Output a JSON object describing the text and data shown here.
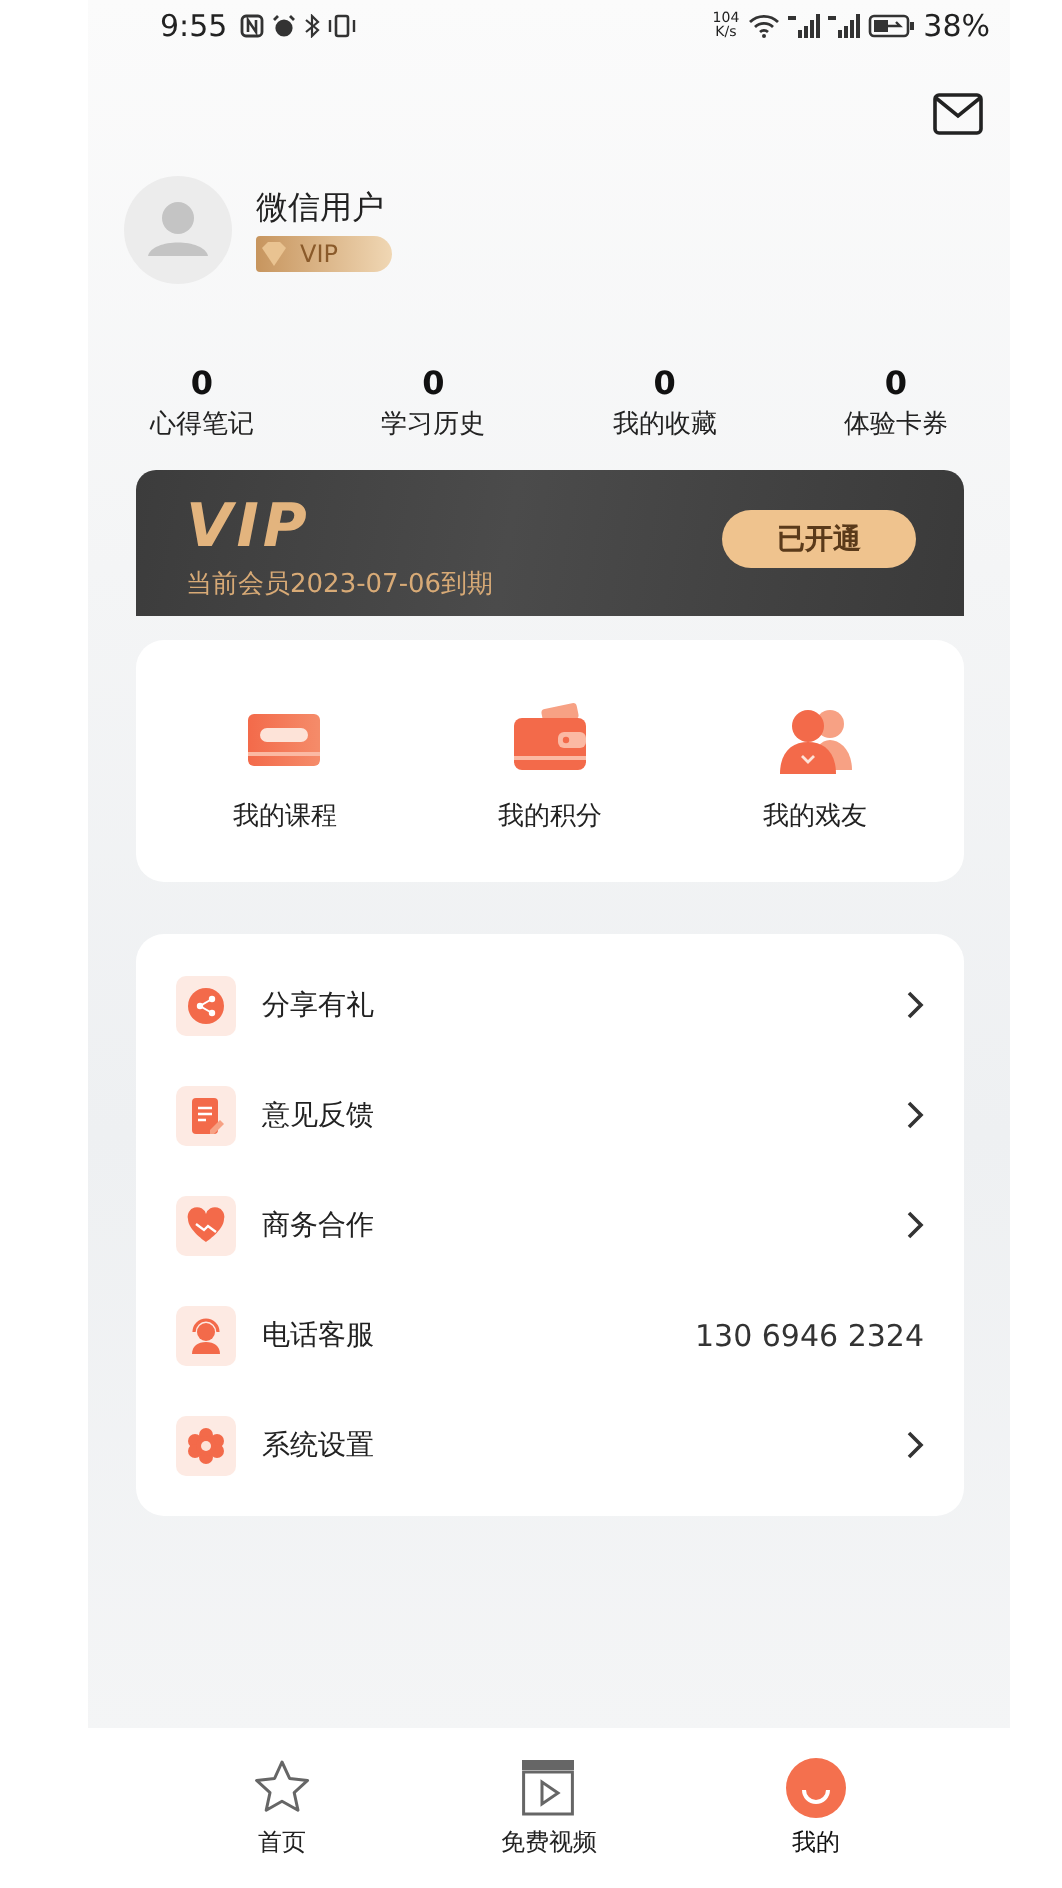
{
  "status_bar": {
    "time": "9:55",
    "speed": "104",
    "speed_unit": "K/s",
    "battery": "38%"
  },
  "profile": {
    "name": "微信用户",
    "badge": "VIP"
  },
  "stats": [
    {
      "value": "0",
      "label": "心得笔记"
    },
    {
      "value": "0",
      "label": "学习历史"
    },
    {
      "value": "0",
      "label": "我的收藏"
    },
    {
      "value": "0",
      "label": "体验卡券"
    }
  ],
  "vip_card": {
    "logo": "VIP",
    "expiry": "当前会员2023-07-06到期",
    "button": "已开通"
  },
  "shortcuts": [
    {
      "kind": "cassette",
      "label": "我的课程"
    },
    {
      "kind": "wallet",
      "label": "我的积分"
    },
    {
      "kind": "people",
      "label": "我的戏友"
    }
  ],
  "menu": [
    {
      "label": "分享有礼",
      "kind": "link"
    },
    {
      "label": "意见反馈",
      "kind": "link"
    },
    {
      "label": "商务合作",
      "kind": "link"
    },
    {
      "label": "电话客服",
      "kind": "value",
      "value": "130 6946 2324"
    },
    {
      "label": "系统设置",
      "kind": "link"
    }
  ],
  "tab_bar": [
    {
      "label": "首页",
      "selected": false
    },
    {
      "label": "免费视频",
      "selected": false
    },
    {
      "label": "我的",
      "selected": true
    }
  ]
}
